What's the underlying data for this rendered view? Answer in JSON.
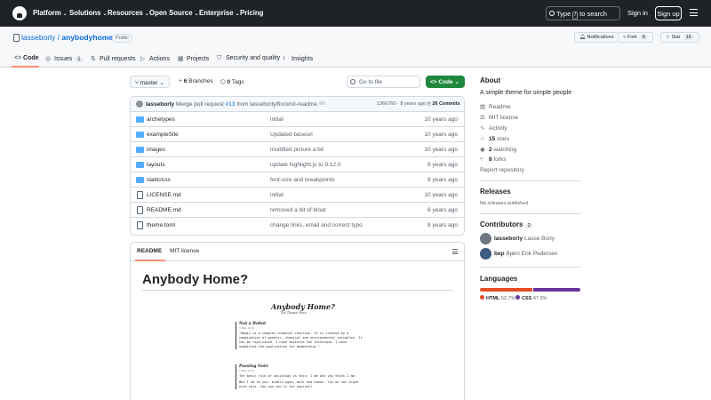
{
  "nav": {
    "items": [
      "Platform",
      "Solutions",
      "Resources",
      "Open Source",
      "Enterprise",
      "Pricing"
    ],
    "search_label": "Type",
    "search_key": "/",
    "search_suffix": "to search",
    "sign_in": "Sign in",
    "sign_up": "Sign up"
  },
  "repo": {
    "owner": "lasseborly",
    "name": "anybodyhome",
    "visibility": "Public",
    "notifications": "Notifications",
    "fork_label": "Fork",
    "fork_count": "8",
    "star_label": "Star",
    "star_count": "15"
  },
  "tabs": [
    {
      "label": "Code",
      "icon": "code-icon"
    },
    {
      "label": "Issues",
      "icon": "issue-icon",
      "count": "1"
    },
    {
      "label": "Pull requests",
      "icon": "pull-request-icon"
    },
    {
      "label": "Actions",
      "icon": "play-icon"
    },
    {
      "label": "Projects",
      "icon": "table-icon"
    },
    {
      "label": "Security and quality",
      "icon": "shield-icon"
    },
    {
      "label": "Insights",
      "icon": "graph-icon"
    }
  ],
  "toolbar": {
    "branch": "master",
    "branches_count": "6",
    "branches_label": "Branches",
    "tags_count": "0",
    "tags_label": "Tags",
    "goto_placeholder": "Go to file",
    "code_label": "Code"
  },
  "commit": {
    "author": "lasseborly",
    "message_prefix": "Merge pull request",
    "pr": "#13",
    "message_suffix": "from lasseborly/fix/omit-readme",
    "sha": "1366760",
    "age": "8 years ago",
    "commits_count": "26",
    "commits_label": "Commits"
  },
  "files": [
    {
      "type": "folder",
      "name": "archetypes",
      "message": "initial",
      "date": "10 years ago"
    },
    {
      "type": "folder",
      "name": "exampleSite",
      "message": "Updated baseurl",
      "date": "10 years ago"
    },
    {
      "type": "folder",
      "name": "images",
      "message": "modified picture a bit",
      "date": "10 years ago"
    },
    {
      "type": "folder",
      "name": "layouts",
      "message": "update highlight.js to 9.12.0",
      "date": "8 years ago"
    },
    {
      "type": "folder",
      "name": "static/css",
      "message": "font-size and breakpoints",
      "date": "8 years ago"
    },
    {
      "type": "file",
      "name": "LICENSE.md",
      "message": "initial",
      "date": "10 years ago"
    },
    {
      "type": "file",
      "name": "README.md",
      "message": "removed a bit of bloat",
      "date": "8 years ago"
    },
    {
      "type": "file",
      "name": "theme.toml",
      "message": "change links, email and correct typo",
      "date": "8 years ago"
    }
  ],
  "readme": {
    "tab_readme": "README",
    "tab_license": "MIT license",
    "heading": "Anybody Home?",
    "preview": {
      "title": "Anybody Home?",
      "subtitle": "The Theme Here",
      "post1_title": "Not a Robot",
      "post1_date": "3 May 2016",
      "post1_text": "\"Magic is a complex chemical reaction. It is created by a combination of genetic, chemical and environmental variables. It can be replicated. I have mastered the technique. I have submitted the application for membership.\"",
      "post2_title": "Passing Note",
      "post2_date": "3 May 2016",
      "post2_text1": "The basic rule of sociology is this: I am who you think I am.",
      "post2_text2": "Who I am to you: middle-aged, male and human. You do not argue with this. You can see it for yourself."
    }
  },
  "about": {
    "heading": "About",
    "description": "A simple theme for simple people",
    "readme": "Readme",
    "license": "MIT license",
    "activity": "Activity",
    "stars_count": "15",
    "stars_label": "stars",
    "watching_count": "2",
    "watching_label": "watching",
    "forks_count": "8",
    "forks_label": "forks",
    "report": "Report repository"
  },
  "releases": {
    "heading": "Releases",
    "empty": "No releases published"
  },
  "contributors": {
    "heading": "Contributors",
    "count": "2",
    "people": [
      {
        "login": "lasseborly",
        "name": "Lasse Borly"
      },
      {
        "login": "bep",
        "name": "Bjørn Erik Pedersen"
      }
    ]
  },
  "languages": {
    "heading": "Languages",
    "items": [
      {
        "name": "HTML",
        "percent": "52.7%",
        "value": 52.7,
        "color": "#e34c26"
      },
      {
        "name": "CSS",
        "percent": "47.3%",
        "value": 47.3,
        "color": "#663399"
      }
    ]
  }
}
